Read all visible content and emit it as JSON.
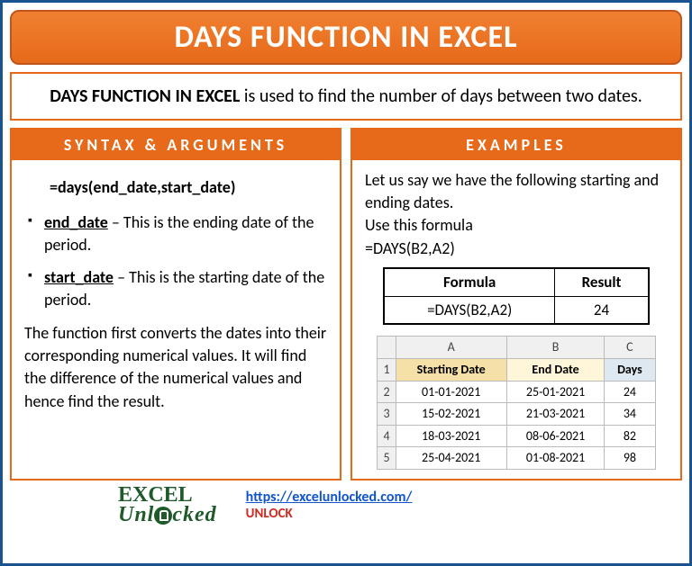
{
  "title": "DAYS FUNCTION IN EXCEL",
  "description": {
    "strong": "DAYS FUNCTION IN EXCEL",
    "rest": " is used to find the number of days between two dates."
  },
  "syntax": {
    "header": "SYNTAX & ARGUMENTS",
    "formula": "=days(end_date,start_date)",
    "args": [
      {
        "name": "end_date",
        "desc": " – This is the ending date of the period."
      },
      {
        "name": "start_date",
        "desc": " – This is the starting date of the period."
      }
    ],
    "explain": "The function first converts the dates into their corresponding numerical values. It will find the difference of the numerical values and hence find the result."
  },
  "examples": {
    "header": "EXAMPLES",
    "intro1": "Let us say we have the following starting and ending dates.",
    "intro2": "Use this formula",
    "formula": "=DAYS(B2,A2)",
    "formula_result": {
      "headers": [
        "Formula",
        "Result"
      ],
      "row": [
        "=DAYS(B2,A2)",
        "24"
      ]
    },
    "sheet": {
      "cols": [
        "A",
        "B",
        "C"
      ],
      "headers": [
        "Starting Date",
        "End Date",
        "Days"
      ],
      "rows": [
        [
          "01-01-2021",
          "25-01-2021",
          "24"
        ],
        [
          "15-02-2021",
          "21-03-2021",
          "34"
        ],
        [
          "18-03-2021",
          "08-06-2021",
          "82"
        ],
        [
          "25-04-2021",
          "01-08-2021",
          "98"
        ]
      ]
    }
  },
  "footer": {
    "logo_line1": "EXCEL",
    "logo_line2": "Unlocked",
    "url": "https://excelunlocked.com/",
    "unlock": "UNLOCK"
  }
}
